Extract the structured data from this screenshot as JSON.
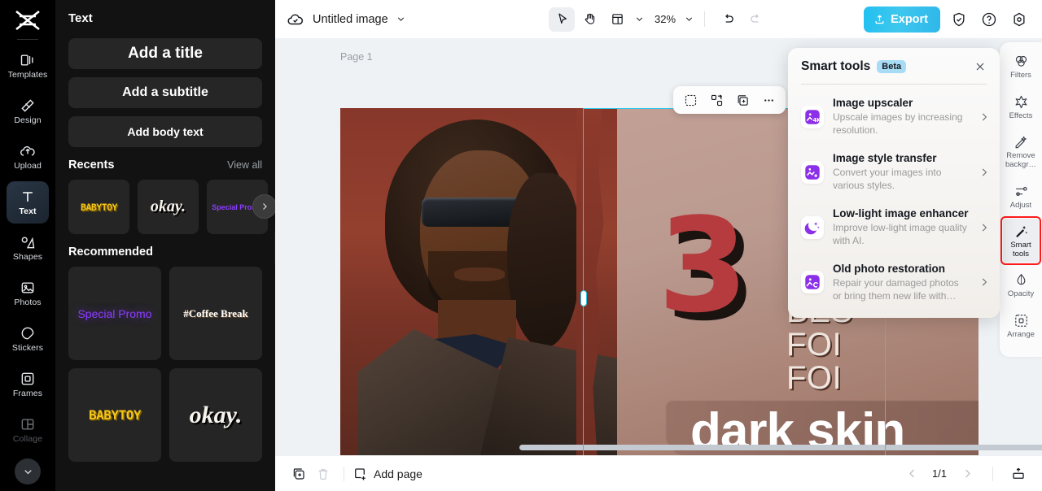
{
  "rail": {
    "logo": "capcut-logo",
    "items": [
      {
        "label": "Templates",
        "icon": "templates-icon",
        "active": false
      },
      {
        "label": "Design",
        "icon": "design-icon",
        "active": false
      },
      {
        "label": "Upload",
        "icon": "upload-icon",
        "active": false
      },
      {
        "label": "Text",
        "icon": "text-icon",
        "active": true
      },
      {
        "label": "Shapes",
        "icon": "shapes-icon",
        "active": false
      },
      {
        "label": "Photos",
        "icon": "photos-icon",
        "active": false
      },
      {
        "label": "Stickers",
        "icon": "stickers-icon",
        "active": false
      },
      {
        "label": "Frames",
        "icon": "frames-icon",
        "active": false
      },
      {
        "label": "Collage",
        "icon": "collage-icon",
        "active": false
      }
    ],
    "more_label": "chevron-down"
  },
  "panel": {
    "title": "Text",
    "buttons": [
      {
        "label": "Add a title"
      },
      {
        "label": "Add a subtitle"
      },
      {
        "label": "Add body text"
      }
    ],
    "recents": {
      "title": "Recents",
      "view_all": "View all",
      "items": [
        {
          "text": "BABYTOY",
          "style": "babytoy"
        },
        {
          "text": "okay.",
          "style": "okay"
        },
        {
          "text": "Special Promo",
          "style": "promo"
        }
      ],
      "next_arrow": "chevron-right-icon"
    },
    "recommended": {
      "title": "Recommended",
      "items": [
        {
          "text": "Special Promo",
          "style": "promo-lg"
        },
        {
          "text": "#Coffee Break",
          "style": "coffee"
        },
        {
          "text": "BABYTOY",
          "style": "babytoy"
        },
        {
          "text": "okay.",
          "style": "okay"
        }
      ]
    },
    "collapse": "‹"
  },
  "topbar": {
    "cloud_icon": "cloud-saved-icon",
    "doc_title": "Untitled image",
    "title_caret": "chevron-down-icon",
    "tools": [
      {
        "name": "select-tool",
        "icon": "cursor-icon",
        "selected": true
      },
      {
        "name": "hand-tool",
        "icon": "hand-icon",
        "selected": false
      },
      {
        "name": "layout-tool",
        "icon": "layout-icon",
        "selected": false
      }
    ],
    "layout_caret": "chevron-down-icon",
    "zoom": "32%",
    "zoom_caret": "chevron-down-icon",
    "undo": "undo-icon",
    "redo": "redo-icon",
    "export_label": "Export",
    "export_icon": "upload-arrow-icon",
    "shield_icon": "shield-check-icon",
    "help_icon": "question-circle-icon",
    "settings_icon": "gear-icon",
    "export_color": "#2fbdee"
  },
  "canvas": {
    "page_label": "Page 1",
    "float_toolbar": [
      {
        "name": "cutout-icon"
      },
      {
        "name": "replace-icon"
      },
      {
        "name": "duplicate-icon"
      },
      {
        "name": "more-options-icon"
      }
    ],
    "artwork": {
      "number": "3",
      "headline": "BES\nFOI\nFOI",
      "subtitle": "dark skin",
      "number_color": "#b63b3e"
    },
    "rotate_handle": "rotate-icon"
  },
  "popover": {
    "title": "Smart tools",
    "badge": "Beta",
    "close": "close-icon",
    "items": [
      {
        "name": "Image upscaler",
        "desc": "Upscale images by increasing resolution.",
        "icon": "image-upscaler-4k-icon"
      },
      {
        "name": "Image style transfer",
        "desc": "Convert your images into various styles.",
        "icon": "image-style-transfer-icon"
      },
      {
        "name": "Low-light image enhancer",
        "desc": "Improve low-light image quality with AI.",
        "icon": "moon-stars-icon"
      },
      {
        "name": "Old photo restoration",
        "desc": "Repair your damaged photos or bring them new life with…",
        "icon": "old-photo-restoration-icon"
      }
    ],
    "chevron": "chevron-right-icon"
  },
  "rside": {
    "items": [
      {
        "label": "Filters",
        "icon": "filters-icon",
        "active": false,
        "highlight": false
      },
      {
        "label": "Effects",
        "icon": "effects-icon",
        "active": false,
        "highlight": false
      },
      {
        "label": "Remove\nbackgr…",
        "icon": "remove-bg-icon",
        "active": false,
        "highlight": false
      },
      {
        "label": "Adjust",
        "icon": "adjust-icon",
        "active": false,
        "highlight": false
      },
      {
        "label": "Smart\ntools",
        "icon": "smart-tools-icon",
        "active": true,
        "highlight": true
      },
      {
        "label": "Opacity",
        "icon": "opacity-icon",
        "active": false,
        "highlight": false
      },
      {
        "label": "Arrange",
        "icon": "arrange-icon",
        "active": false,
        "highlight": false
      }
    ],
    "highlight_color": "#ff1a1a"
  },
  "bottombar": {
    "duplicate_icon": "duplicate-page-icon",
    "delete_icon": "trash-icon",
    "add_page_label": "Add page",
    "add_page_icon": "add-page-icon",
    "prev_icon": "chevron-left-icon",
    "page_indicator": "1/1",
    "next_icon": "chevron-right-icon",
    "present_icon": "present-icon"
  }
}
